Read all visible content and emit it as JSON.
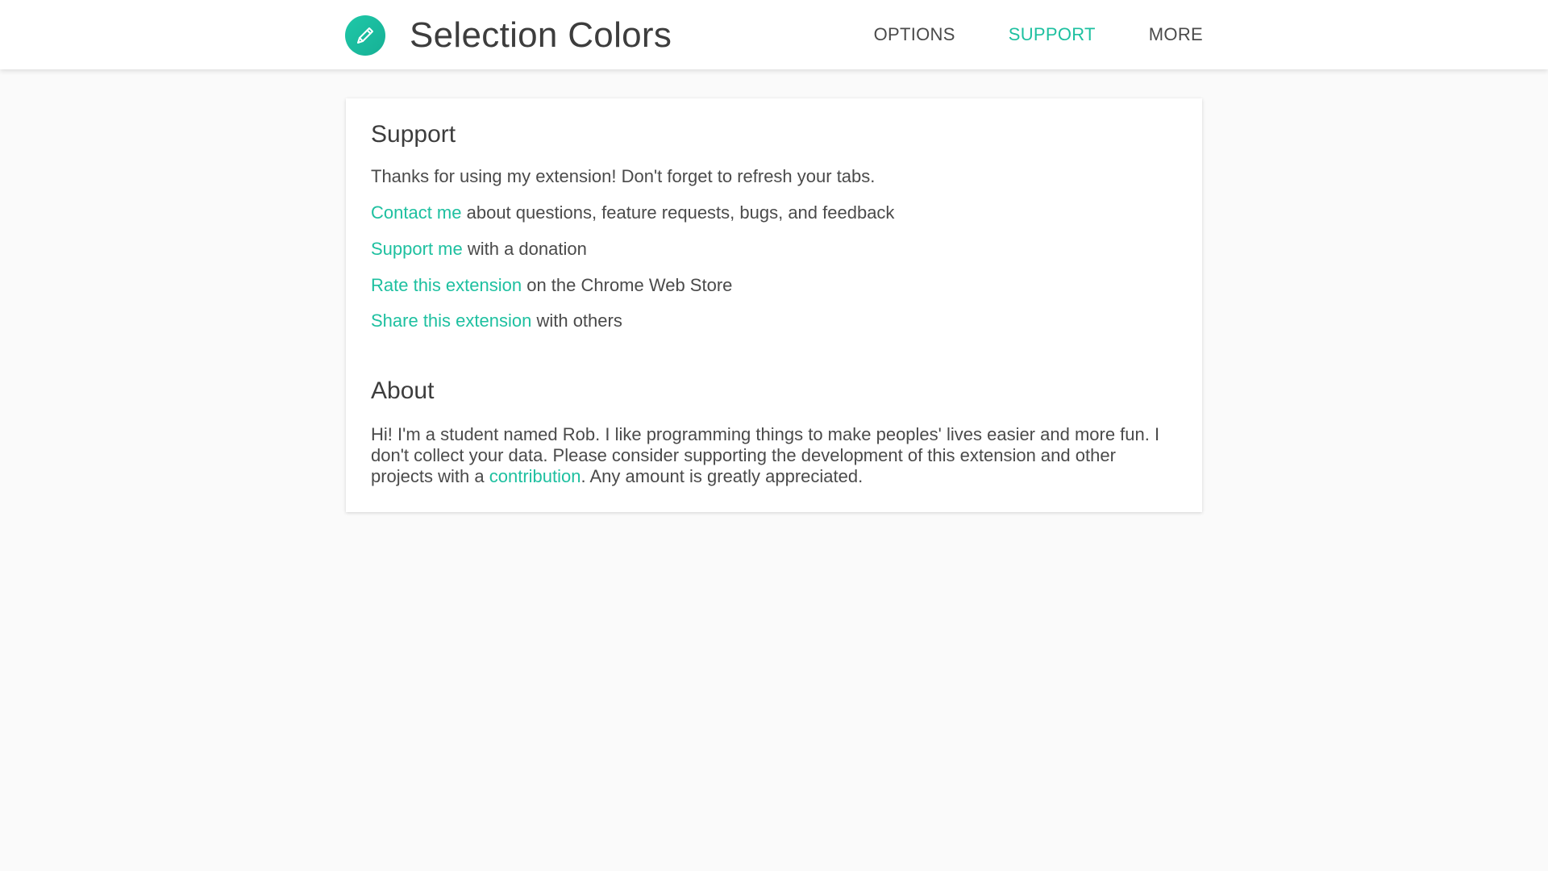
{
  "header": {
    "title": "Selection Colors",
    "logo_icon": "pencil-icon",
    "nav": [
      {
        "label": "OPTIONS",
        "active": false
      },
      {
        "label": "SUPPORT",
        "active": true
      },
      {
        "label": "MORE",
        "active": false
      }
    ]
  },
  "support": {
    "heading": "Support",
    "intro": "Thanks for using my extension! Don't forget to refresh your tabs.",
    "items": [
      {
        "link": "Contact me",
        "text": " about questions, feature requests, bugs, and feedback"
      },
      {
        "link": "Support me",
        "text": " with a donation"
      },
      {
        "link": "Rate this extension",
        "text": " on the Chrome Web Store"
      },
      {
        "link": "Share this extension",
        "text": " with others"
      }
    ]
  },
  "about": {
    "heading": "About",
    "text_before": "Hi! I'm a student named Rob. I like programming things to make peoples' lives easier and more fun. I don't collect your data. Please consider supporting the development of this extension and other projects with a ",
    "link": "contribution",
    "text_after": ". Any amount is greatly appreciated."
  },
  "colors": {
    "accent": "#1ec0a0",
    "text": "#4a4a4a",
    "background": "#fafafa"
  }
}
